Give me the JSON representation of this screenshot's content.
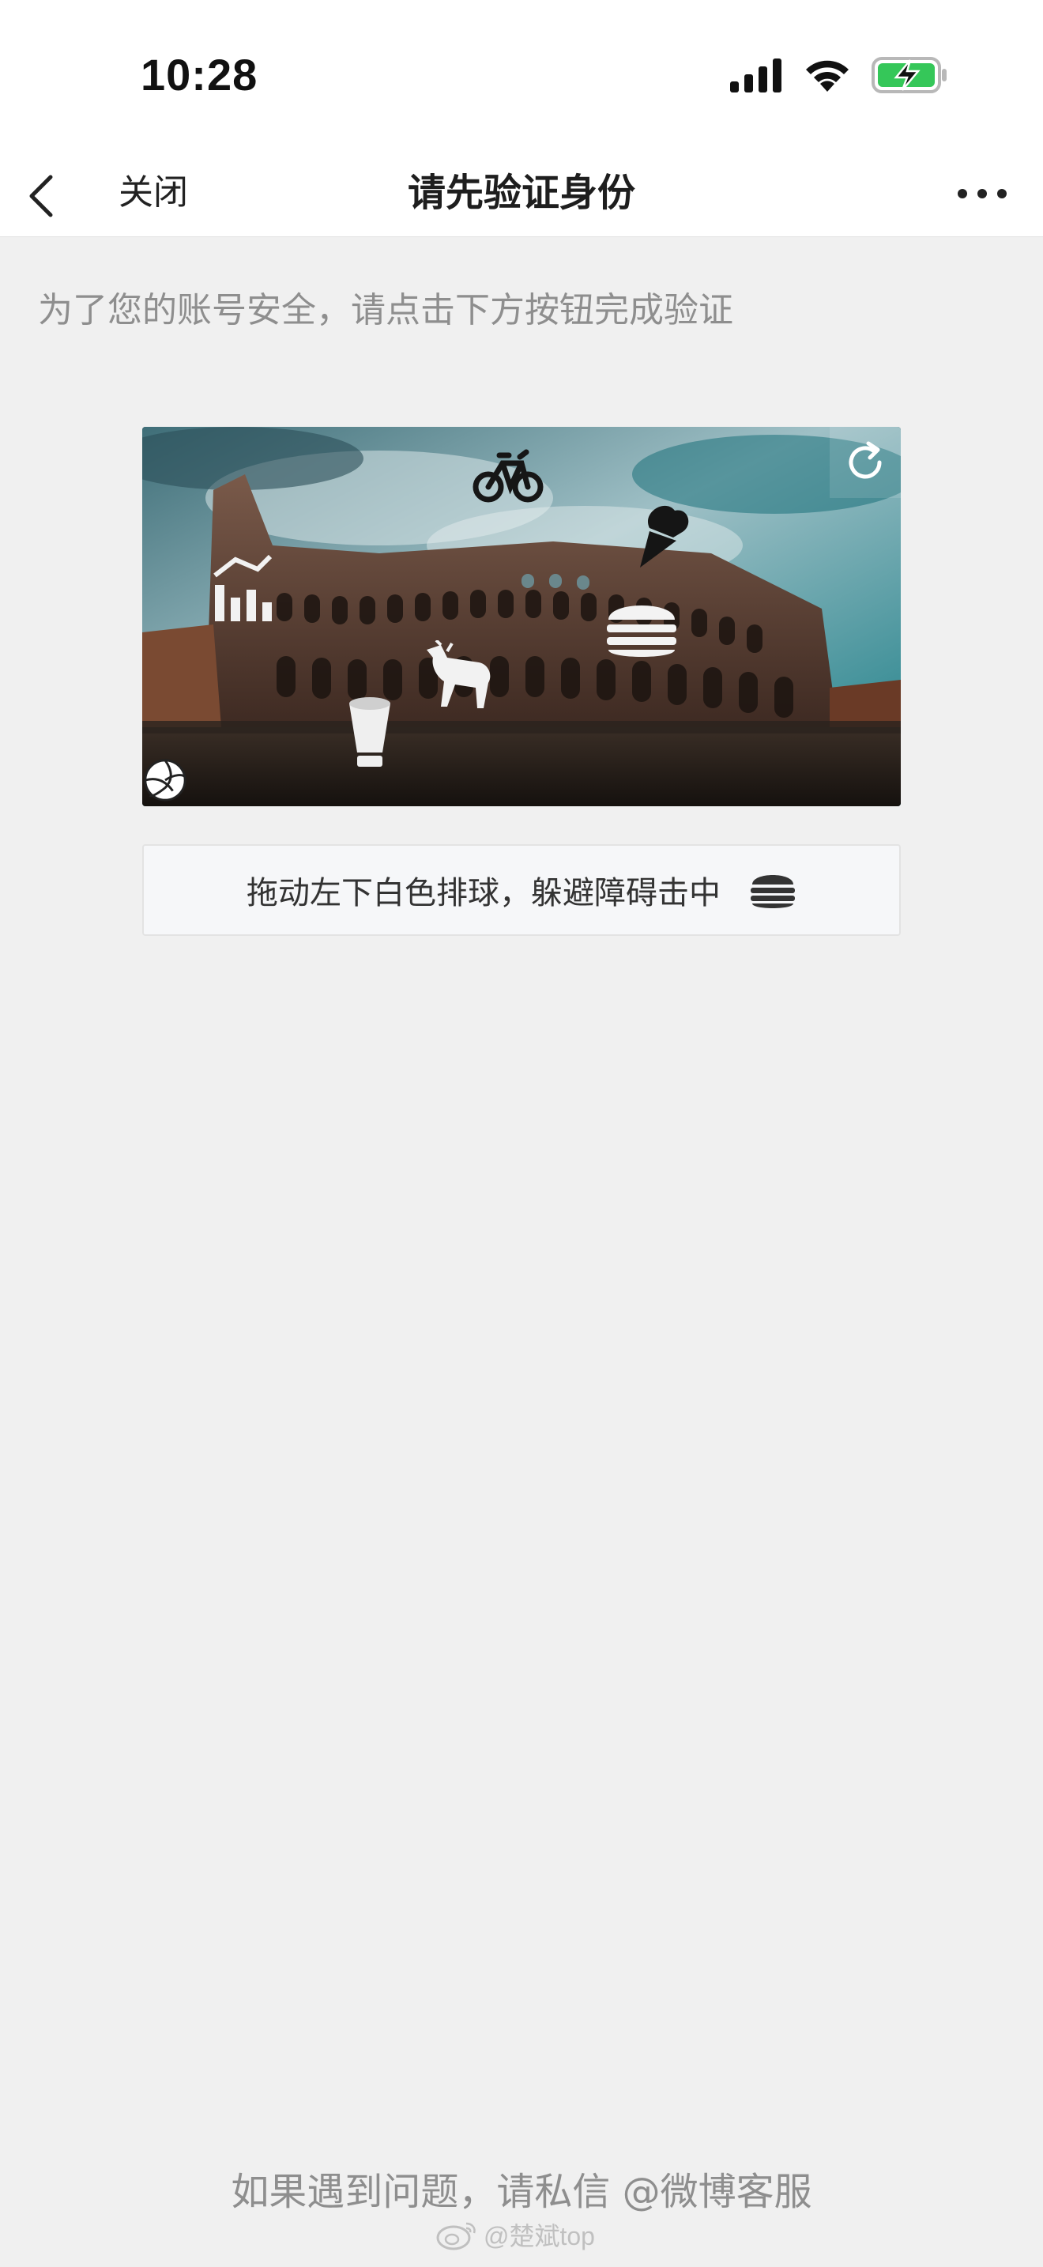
{
  "status_bar": {
    "time": "10:28",
    "icons": [
      "signal-icon",
      "wifi-icon",
      "battery-charging-icon"
    ],
    "battery_color": "#35c759"
  },
  "nav": {
    "close_label": "关闭",
    "title": "请先验证身份",
    "icons": [
      "back-arrow-icon",
      "more-dots-icon"
    ]
  },
  "hint": "为了您的账号安全，请点击下方按钮完成验证",
  "captcha": {
    "background": "colosseum-photo",
    "obstacles": [
      "bicycle-icon",
      "ice-cream-icon",
      "bar-chart-icon",
      "burger-icon",
      "goat-icon",
      "megaphone-icon"
    ],
    "draggable": "volleyball-icon",
    "refresh_icon": "refresh-icon",
    "instruction": "拖动左下白色排球，躲避障碍击中",
    "target_icon": "burger-icon"
  },
  "footer": {
    "help_text": "如果遇到问题，请私信 @微博客服",
    "watermark": "@楚斌top"
  },
  "colors": {
    "background": "#f0f0f0",
    "hint_text": "#8e8e8e",
    "instruction_bg": "#f6f7f9"
  }
}
